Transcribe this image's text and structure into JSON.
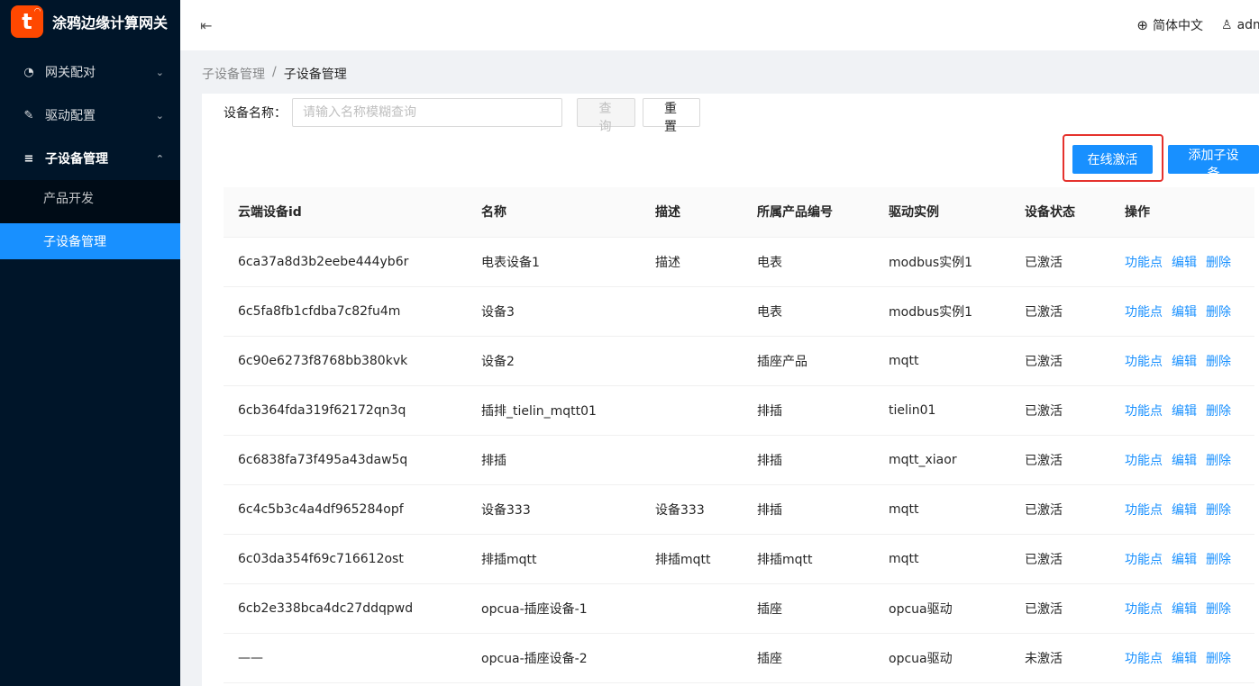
{
  "brand": {
    "logo_letter": "t",
    "title": "涂鸦边缘计算网关"
  },
  "sidebar": {
    "items": [
      {
        "label": "网关配对",
        "icon": "dashboard-icon"
      },
      {
        "label": "驱动配置",
        "icon": "edit-icon"
      },
      {
        "label": "子设备管理",
        "icon": "menu-icon"
      }
    ],
    "subitems": [
      {
        "label": "产品开发"
      },
      {
        "label": "子设备管理"
      }
    ]
  },
  "header": {
    "language": "简体中文",
    "user": "admin"
  },
  "breadcrumb": {
    "parent": "子设备管理",
    "separator": "/",
    "current": "子设备管理"
  },
  "search": {
    "label": "设备名称：",
    "placeholder": "请输入名称模糊查询",
    "query_label": "查 询",
    "reset_label": "重 置"
  },
  "actions": {
    "activate_label": "在线激活",
    "add_label": "添加子设备"
  },
  "table": {
    "columns": [
      "云端设备id",
      "名称",
      "描述",
      "所属产品编号",
      "驱动实例",
      "设备状态",
      "操作"
    ],
    "rows": [
      {
        "id": "6ca37a8d3b2eebe444yb6r",
        "name": "电表设备1",
        "desc": "描述",
        "product": "电表",
        "driver": "modbus实例1",
        "status": "已激活"
      },
      {
        "id": "6c5fa8fb1cfdba7c82fu4m",
        "name": "设备3",
        "desc": "",
        "product": "电表",
        "driver": "modbus实例1",
        "status": "已激活"
      },
      {
        "id": "6c90e6273f8768bb380kvk",
        "name": "设备2",
        "desc": "",
        "product": "插座产品",
        "driver": "mqtt",
        "status": "已激活"
      },
      {
        "id": "6cb364fda319f62172qn3q",
        "name": "插排_tielin_mqtt01",
        "desc": "",
        "product": "排插",
        "driver": "tielin01",
        "status": "已激活"
      },
      {
        "id": "6c6838fa73f495a43daw5q",
        "name": "排插",
        "desc": "",
        "product": "排插",
        "driver": "mqtt_xiaor",
        "status": "已激活"
      },
      {
        "id": "6c4c5b3c4a4df965284opf",
        "name": "设备333",
        "desc": "设备333",
        "product": "排插",
        "driver": "mqtt",
        "status": "已激活"
      },
      {
        "id": "6c03da354f69c716612ost",
        "name": "排插mqtt",
        "desc": "排插mqtt",
        "product": "排插mqtt",
        "driver": "mqtt",
        "status": "已激活"
      },
      {
        "id": "6cb2e338bca4dc27ddqpwd",
        "name": "opcua-插座设备-1",
        "desc": "",
        "product": "插座",
        "driver": "opcua驱动",
        "status": "已激活"
      },
      {
        "id": "——",
        "name": "opcua-插座设备-2",
        "desc": "",
        "product": "插座",
        "driver": "opcua驱动",
        "status": "未激活"
      }
    ],
    "ops": [
      "功能点",
      "编辑",
      "删除"
    ]
  },
  "colors": {
    "primary": "#1890ff",
    "sidebar_bg": "#001529",
    "active_status": "#52c41a",
    "inactive_status": "#8c8c8c",
    "highlight": "#e5322d"
  }
}
